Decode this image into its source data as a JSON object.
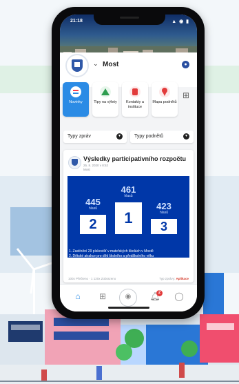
{
  "status": {
    "time": "21:18",
    "icons": "▲ ◉ ▮"
  },
  "city": {
    "name": "Most"
  },
  "tiles": [
    {
      "label": "Novinky",
      "color": "#ff3b4a",
      "active": true
    },
    {
      "label": "Tipy na výlety",
      "color": "#2e9d4f",
      "active": false
    },
    {
      "label": "Kontakty a instituce",
      "color": "#e23b3b",
      "active": false
    },
    {
      "label": "Mapa podnětů",
      "color": "#e23b3b",
      "active": false
    }
  ],
  "filters": {
    "news_type": "Typy zpráv",
    "report_type": "Typy podnětů"
  },
  "post": {
    "title": "Výsledky participativního rozpočtu",
    "date": "25. 8. 2020 v 8:52",
    "source": "Most",
    "results": [
      {
        "rank": "2",
        "votes": "445",
        "unit": "hlasů"
      },
      {
        "rank": "1",
        "votes": "461",
        "unit": "hlasů"
      },
      {
        "rank": "3",
        "votes": "423",
        "unit": "hlasů"
      }
    ],
    "list": [
      "1. Zastínění 29 pískovišť v mateřských školách v Mostě",
      "2. Dětské atrakce pro děti školního a předškolního věku",
      "3. Bosonožka"
    ],
    "footer_left": "100x Přečteno  · 1 120x Zobrazeno",
    "footer_right_label": "Typ zprávy:",
    "footer_right_value": "Aplikace"
  },
  "tabs": [
    {
      "name": "home",
      "icon": "home-icon"
    },
    {
      "name": "categories",
      "icon": "grid-icon"
    },
    {
      "name": "camera",
      "icon": "camera-icon"
    },
    {
      "name": "notifications",
      "icon": "bell-icon",
      "badge": "2"
    },
    {
      "name": "profile",
      "icon": "user-icon"
    }
  ]
}
